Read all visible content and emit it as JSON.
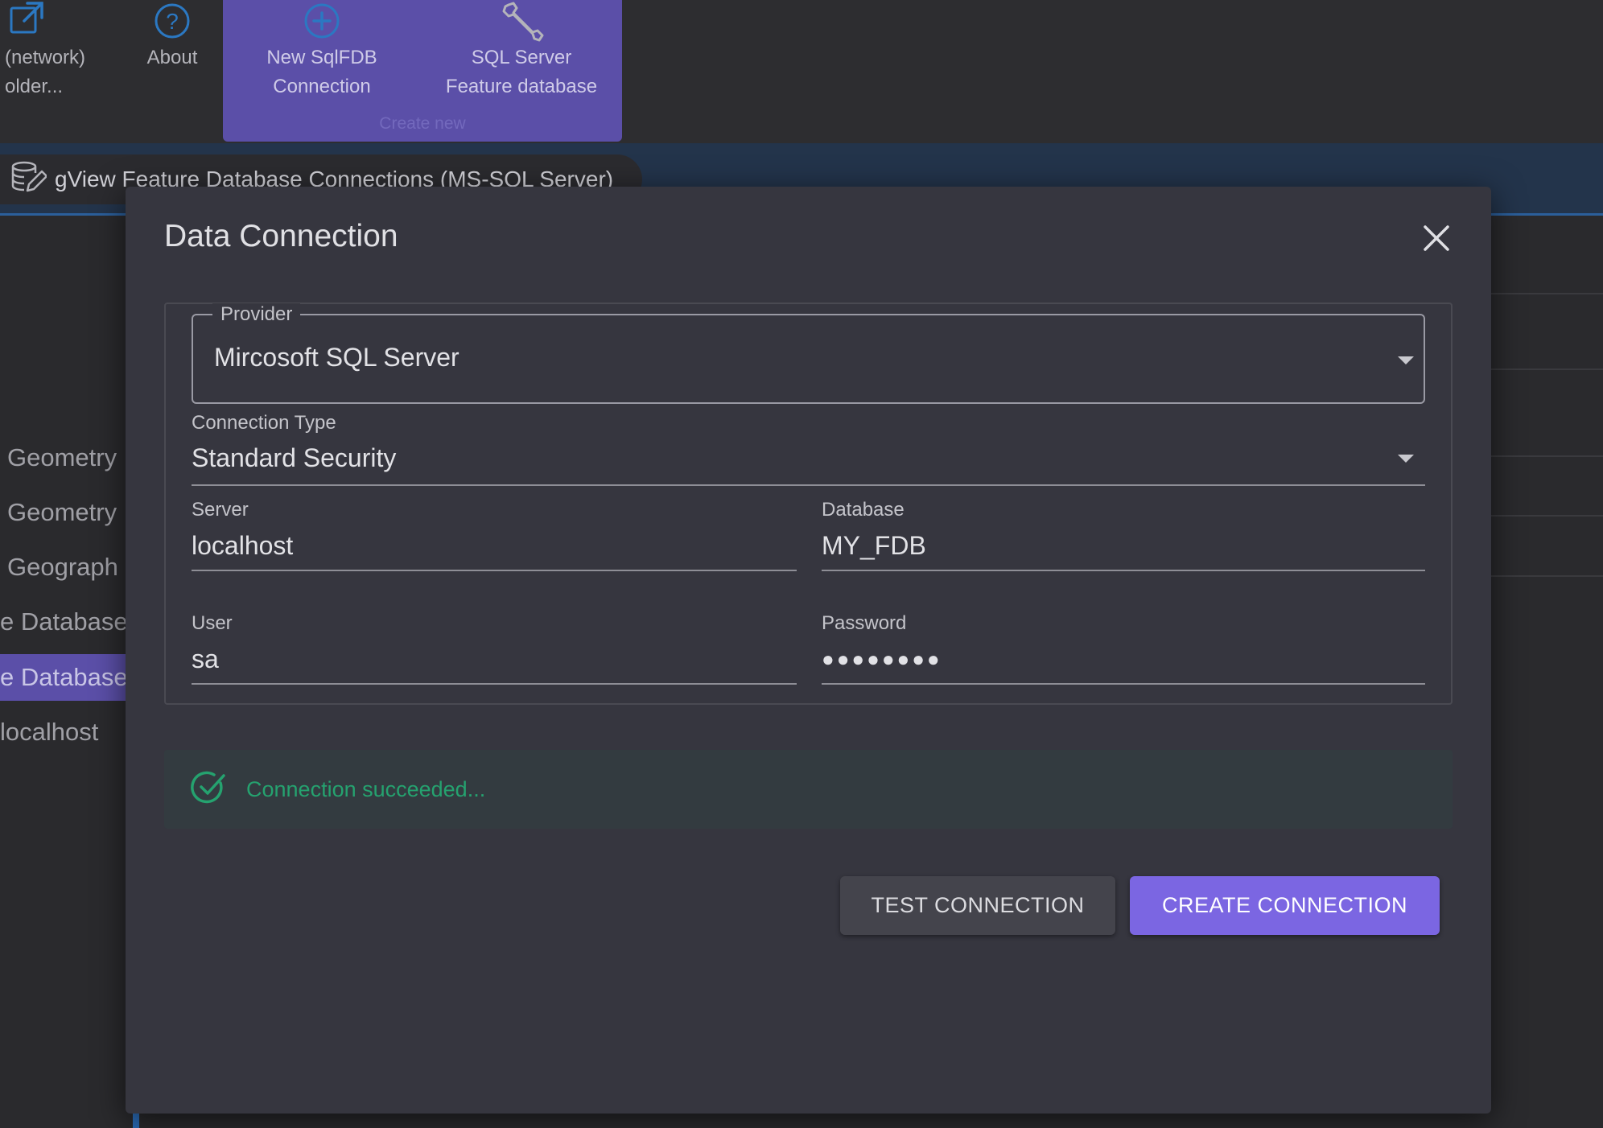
{
  "toolbar": {
    "items": [
      {
        "icon": "external-link-icon",
        "label": "(network)\nolder..."
      },
      {
        "icon": "help-circle-icon",
        "label": "About"
      },
      {
        "icon": "plus-circle-icon",
        "label": "New SqlFDB\nConnection"
      },
      {
        "icon": "wrench-icon",
        "label": "SQL Server\nFeature database"
      }
    ],
    "group_label": "Create new"
  },
  "header": {
    "icon": "database-edit-icon",
    "title": "gView Feature Database Connections (MS-SQL Server)"
  },
  "background_list": [
    {
      "label": "Geometry",
      "selected": false
    },
    {
      "label": "Geometry",
      "selected": false
    },
    {
      "label": "Geograph",
      "selected": false
    },
    {
      "label": "e Database",
      "selected": false
    },
    {
      "label": "e Database",
      "selected": true
    },
    {
      "label": "localhost",
      "selected": false
    }
  ],
  "dialog": {
    "title": "Data Connection",
    "close_icon": "close-icon",
    "provider": {
      "label": "Provider",
      "value": "Mircosoft SQL Server"
    },
    "connection_type": {
      "label": "Connection Type",
      "value": "Standard Security"
    },
    "server": {
      "label": "Server",
      "value": "localhost"
    },
    "database": {
      "label": "Database",
      "value": "MY_FDB"
    },
    "user": {
      "label": "User",
      "value": "sa"
    },
    "password": {
      "label": "Password",
      "value": "●●●●●●●●"
    },
    "status": {
      "icon": "check-circle-icon",
      "text": "Connection succeeded...",
      "color": "#25a26f"
    },
    "buttons": {
      "test": "TEST CONNECTION",
      "create": "CREATE CONNECTION"
    }
  },
  "colors": {
    "accent": "#7b66e2",
    "ribbon_group": "#5b4fa8",
    "header_bar": "#23344b",
    "icon_blue": "#2b78c2",
    "success": "#25a26f"
  }
}
